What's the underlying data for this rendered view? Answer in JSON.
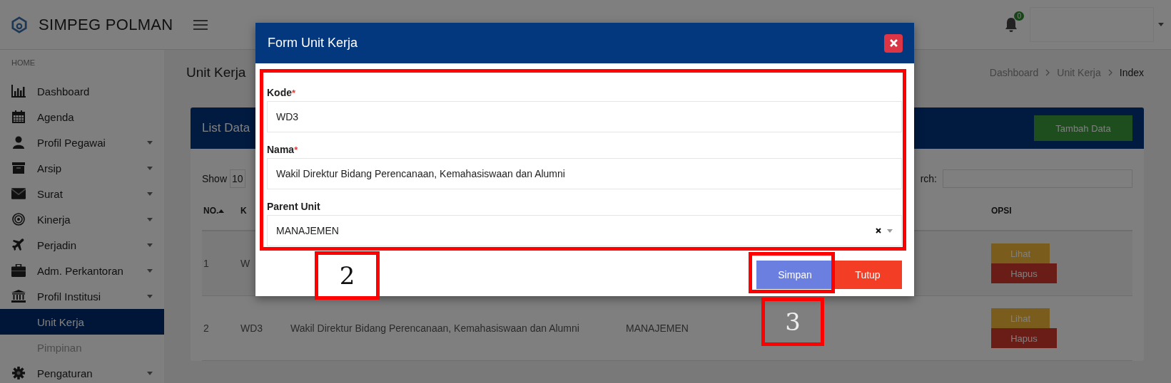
{
  "brand": {
    "title": "SIMPEG POLMAN"
  },
  "topbar": {
    "notification_count": "0"
  },
  "sidebar": {
    "section": "HOME",
    "items": [
      {
        "label": "Dashboard",
        "kind": "menu",
        "expandable": false,
        "selected": false
      },
      {
        "label": "Agenda",
        "kind": "menu",
        "expandable": false,
        "selected": false
      },
      {
        "label": "Profil Pegawai",
        "kind": "menu",
        "expandable": true,
        "selected": false
      },
      {
        "label": "Arsip",
        "kind": "menu",
        "expandable": true,
        "selected": false
      },
      {
        "label": "Surat",
        "kind": "menu",
        "expandable": true,
        "selected": false
      },
      {
        "label": "Kinerja",
        "kind": "menu",
        "expandable": true,
        "selected": false
      },
      {
        "label": "Perjadin",
        "kind": "menu",
        "expandable": true,
        "selected": false
      },
      {
        "label": "Adm. Perkantoran",
        "kind": "menu",
        "expandable": true,
        "selected": false
      },
      {
        "label": "Profil Institusi",
        "kind": "menu",
        "expandable": true,
        "selected": false
      },
      {
        "label": "Unit Kerja",
        "kind": "submenu",
        "expandable": false,
        "selected": true
      },
      {
        "label": "Pimpinan",
        "kind": "submenu",
        "expandable": false,
        "selected": false
      },
      {
        "label": "Pengaturan",
        "kind": "menu",
        "expandable": true,
        "selected": false
      }
    ]
  },
  "page": {
    "title": "Unit Kerja",
    "breadcrumb": [
      {
        "label": "Dashboard",
        "current": false
      },
      {
        "label": "Unit Kerja",
        "current": false
      },
      {
        "label": "Index",
        "current": true
      }
    ]
  },
  "card": {
    "title": "List Data",
    "add_button": "Tambah Data",
    "show_label": "Show",
    "page_size": "10",
    "search_label": "rch:",
    "columns": [
      "NO.",
      "K",
      "OPSI"
    ],
    "rows": [
      {
        "no": "1",
        "kode": "W",
        "actions": [
          "Lihat",
          "Hapus"
        ]
      },
      {
        "no": "2",
        "kode": "WD3",
        "nama": "Wakil Direktur Bidang Perencanaan, Kemahasiswaan dan Alumni",
        "parent": "MANAJEMEN",
        "actions": [
          "Lihat",
          "Hapus"
        ]
      }
    ]
  },
  "modal": {
    "title": "Form Unit Kerja",
    "required_mark": "*",
    "fields": [
      {
        "label": "Kode",
        "required": true,
        "kind": "text",
        "value": "WD3"
      },
      {
        "label": "Nama",
        "required": true,
        "kind": "text",
        "value": "Wakil Direktur Bidang Perencanaan, Kemahasiswaan dan Alumni"
      },
      {
        "label": "Parent Unit",
        "required": false,
        "kind": "select",
        "value": "MANAJEMEN"
      }
    ],
    "buttons": [
      {
        "label": "Simpan",
        "kind": "primary"
      },
      {
        "label": "Tutup",
        "kind": "danger"
      }
    ]
  },
  "annotations": [
    {
      "kind": "frame"
    },
    {
      "kind": "tag",
      "label": "2",
      "filled": true
    },
    {
      "kind": "frame"
    },
    {
      "kind": "tag",
      "label": "3",
      "filled": false
    }
  ]
}
